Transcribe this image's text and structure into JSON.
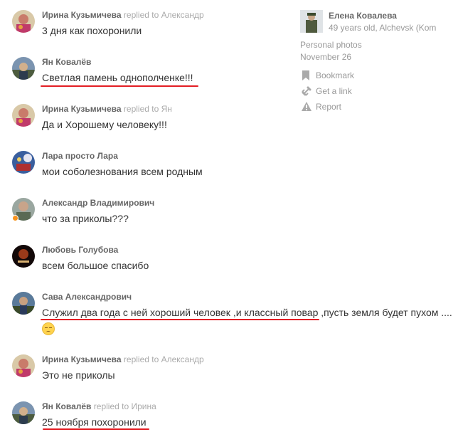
{
  "comments": [
    {
      "author": "Ирина Кузьмичева",
      "reply": "replied to Александр",
      "text": "3 дня как похоронили"
    },
    {
      "author": "Ян Ковалёв",
      "reply": "",
      "text": "Светлая памень однополченке!!!"
    },
    {
      "author": "Ирина Кузьмичева",
      "reply": "replied to Ян",
      "text": "Да и  Хорошему человеку!!!"
    },
    {
      "author": "Лара просто Лара",
      "reply": "",
      "text": "мои соболезнования всем родным"
    },
    {
      "author": "Александр Владимирович",
      "reply": "",
      "text": "что за приколы???"
    },
    {
      "author": "Любовь Голубова",
      "reply": "",
      "text": "всем большое спасибо"
    },
    {
      "author": "Сава Александрович",
      "reply": "",
      "text": "Служил два года с ней хороший человек ,и классный повар ,пусть земля будет пухом ....",
      "emoji": "sad-face-emoji"
    },
    {
      "author": "Ирина Кузьмичева",
      "reply": "replied to Александр",
      "text": "Это не приколы"
    },
    {
      "author": "Ян Ковалёв",
      "reply": "replied to Ирина",
      "text": "25 ноября похоронили"
    }
  ],
  "sidebar": {
    "name": "Елена Ковалева",
    "info": "49 years old, Alchevsk (Kom",
    "album": "Personal photos",
    "date": "November 26",
    "actions": [
      {
        "label": "Bookmark",
        "icon": "bookmark-icon"
      },
      {
        "label": "Get a link",
        "icon": "link-icon"
      },
      {
        "label": "Report",
        "icon": "warning-icon"
      }
    ]
  },
  "colors": {
    "underline": "#e31e24",
    "author": "#666666",
    "muted": "#aaaaaa",
    "accent": "#f7931e"
  }
}
